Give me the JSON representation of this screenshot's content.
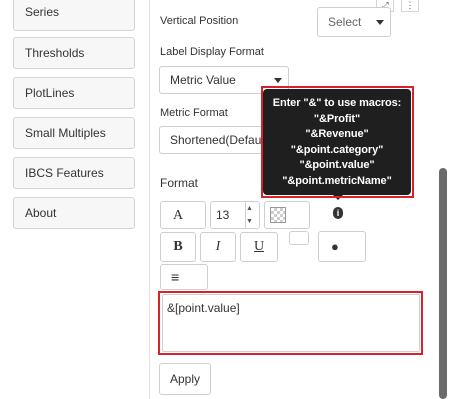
{
  "sidebar": {
    "items": [
      {
        "label": "Series"
      },
      {
        "label": "Thresholds"
      },
      {
        "label": "PlotLines"
      },
      {
        "label": "Small Multiples"
      },
      {
        "label": "IBCS Features"
      },
      {
        "label": "About"
      }
    ]
  },
  "panel": {
    "vertical_position_label": "Vertical Position",
    "vertical_position_value": "Select",
    "label_display_format_label": "Label Display Format",
    "label_display_format_value": "Metric Value",
    "metric_format_label": "Metric Format",
    "metric_format_value": "Shortened(Default)",
    "format_title": "Format",
    "font_size_value": "13",
    "bold_label": "B",
    "italic_label": "I",
    "underline_label": "U",
    "info_glyph": "i",
    "bullet_glyph": "●",
    "align_glyph": "≡",
    "font_glyph": "A",
    "textarea_value": "&[point.value]",
    "apply_label": "Apply"
  },
  "tooltip": {
    "lines": [
      "Enter \"&\" to use macros:",
      "\"&Profit\"",
      "\"&Revenue\"",
      "\"&point.category\"",
      "\"&point.value\"",
      "\"&point.metricName\""
    ]
  },
  "icons": {
    "expand": "expand-icon",
    "more": "more-icon",
    "info": "info-icon",
    "caret": "caret-down-icon",
    "align": "align-icon",
    "color": "color-swatch-icon"
  },
  "colors": {
    "highlight_red": "#d6232b",
    "tooltip_bg": "#1f1f1f",
    "scroll_thumb": "#6b6b6b"
  }
}
